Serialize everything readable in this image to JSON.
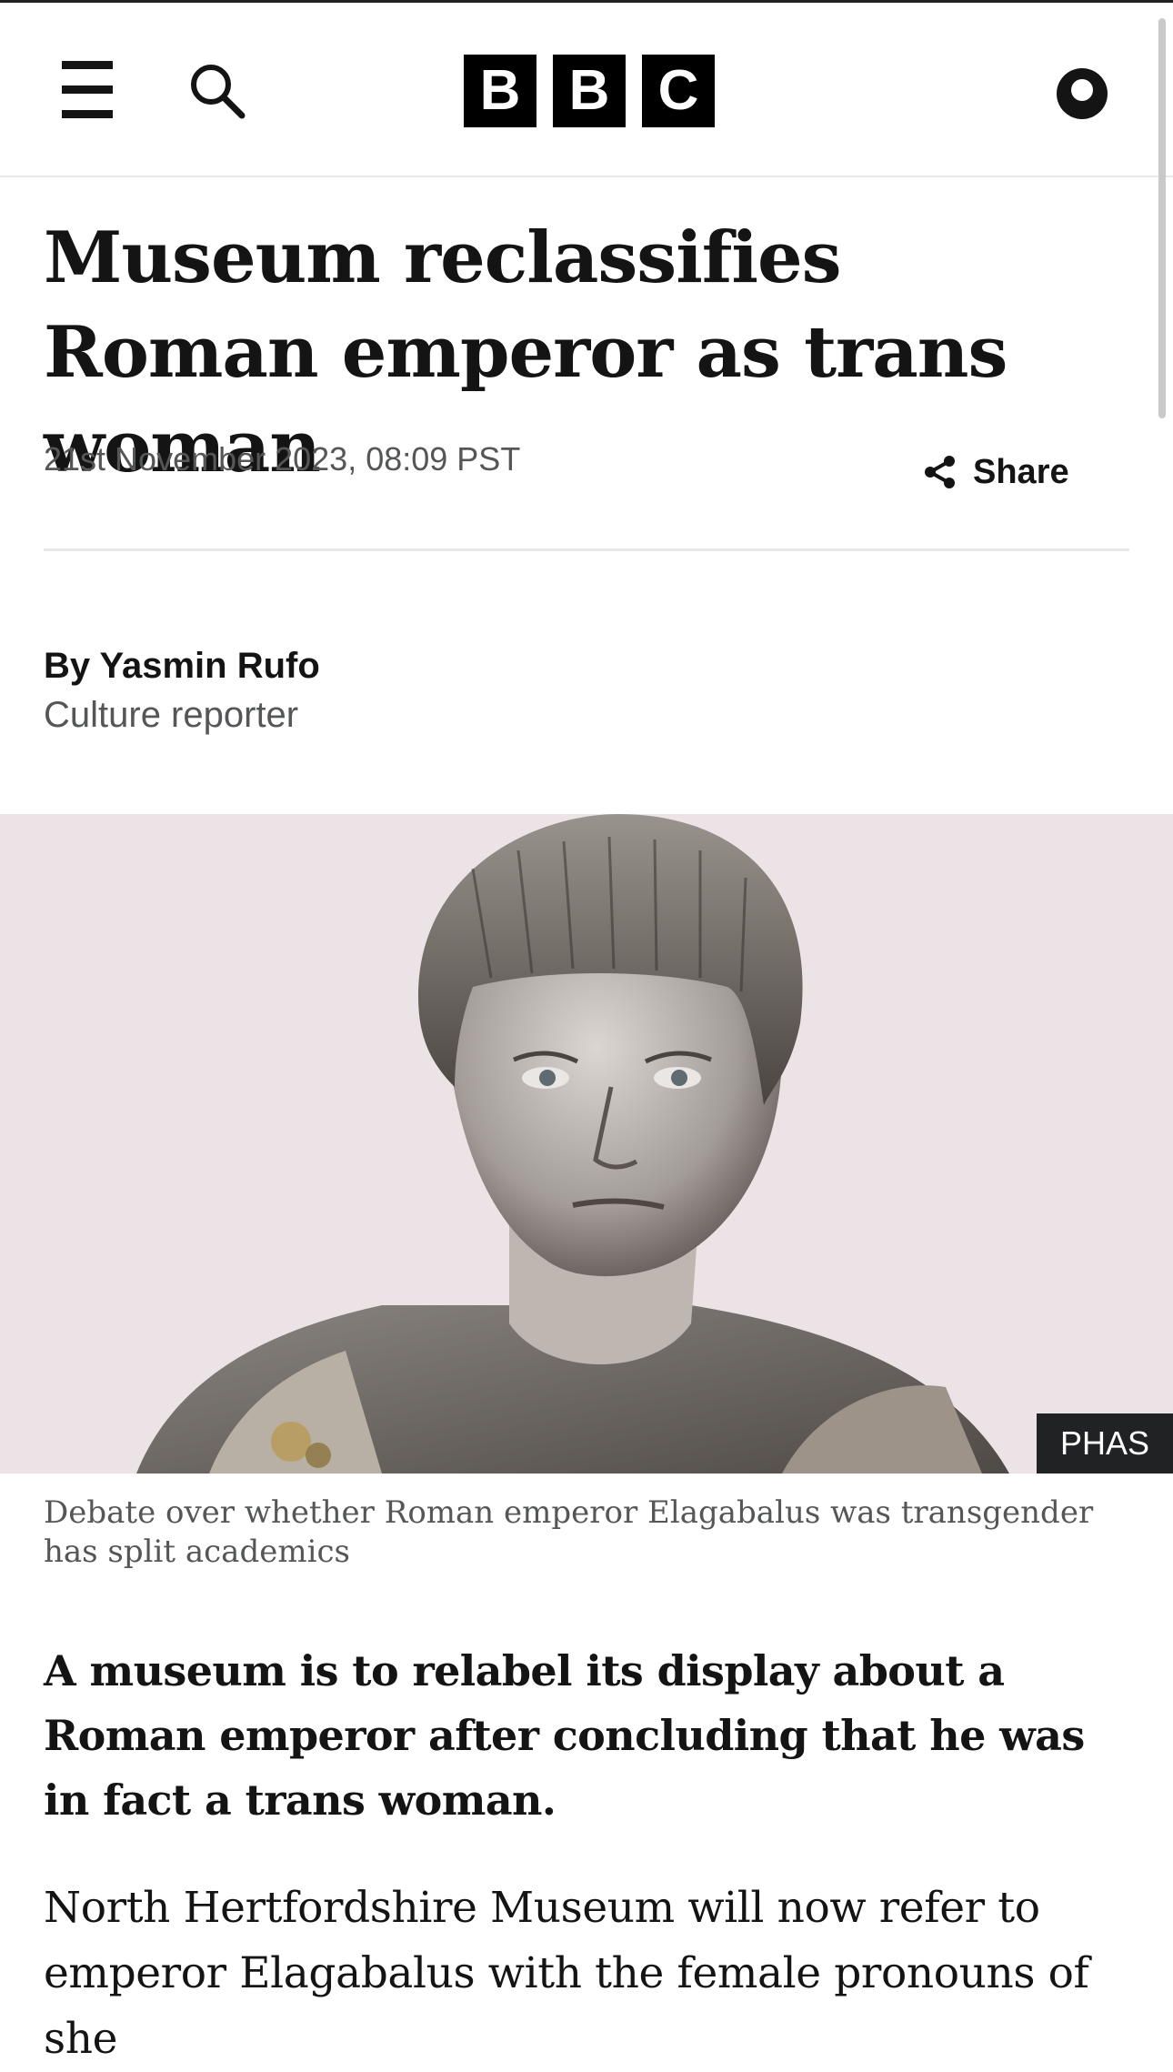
{
  "header": {
    "logo_letters": [
      "B",
      "B",
      "C"
    ],
    "icons": {
      "menu": "hamburger-menu-icon",
      "search": "search-icon",
      "account": "account-icon"
    }
  },
  "article": {
    "headline": "Museum reclassifies Roman emperor as trans woman",
    "timestamp": "21st November 2023, 08:09 PST",
    "share_label": "Share",
    "byline": {
      "name": "By Yasmin Rufo",
      "role": "Culture reporter"
    },
    "image": {
      "credit": "PHAS",
      "caption": "Debate over whether Roman emperor Elagabalus was transgender has split academics"
    },
    "lead": "A museum is to relabel its display about a Roman emperor after concluding that he was in fact a trans woman.",
    "body": "North Hertfordshire Museum will now refer to emperor Elagabalus with the female pronouns of she"
  },
  "colors": {
    "text": "#141414",
    "secondary_text": "#545658",
    "divider": "#e6e8ea",
    "logo_block": "#000000",
    "credit_bg": "#202224"
  }
}
